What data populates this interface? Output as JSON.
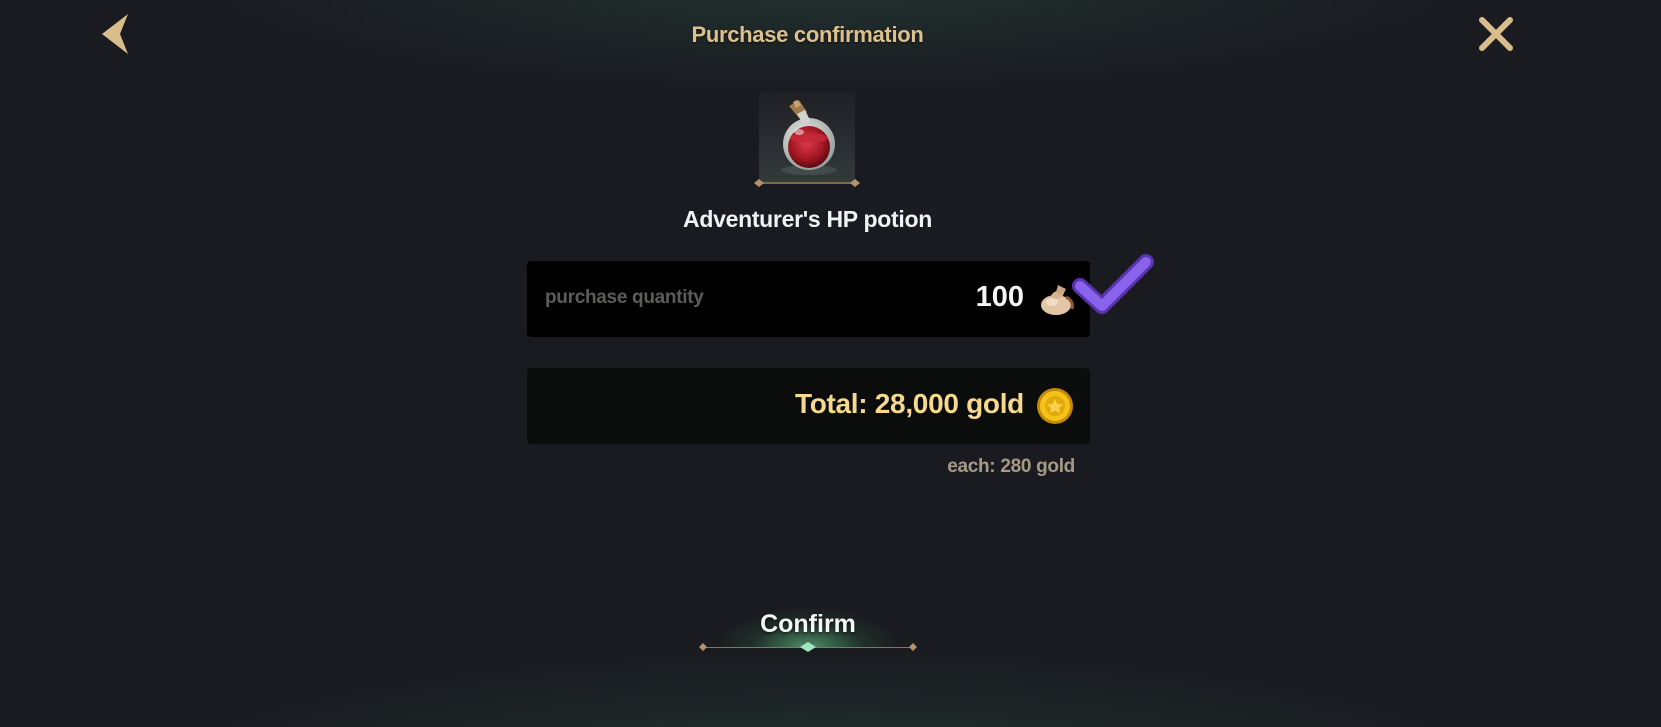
{
  "header": {
    "title": "Purchase confirmation",
    "back_icon": "back-arrow-icon",
    "close_icon": "close-icon"
  },
  "item": {
    "name": "Adventurer's HP potion",
    "icon": "hp-potion-icon"
  },
  "quantity": {
    "label": "purchase quantity",
    "value": "100",
    "icon": "pouch-icon"
  },
  "overlay": {
    "icon": "checkmark-icon",
    "color": "#7b4fe0"
  },
  "total": {
    "text": "Total: 28,000 gold",
    "icon": "gold-coin-icon"
  },
  "unit_price": {
    "text": "each: 280 gold"
  },
  "confirm": {
    "label": "Confirm"
  },
  "colors": {
    "title": "#dcc08e",
    "total": "#f6d88f",
    "accent_green": "#78e6a0",
    "background": "#1a1b20"
  }
}
